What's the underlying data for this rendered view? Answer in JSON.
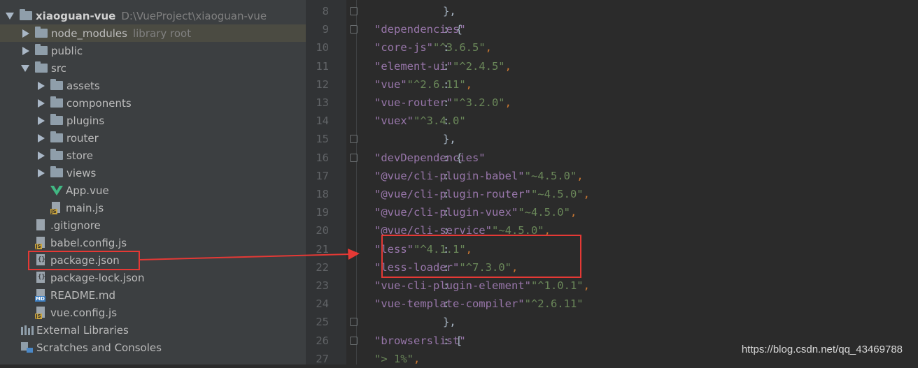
{
  "project": {
    "name": "xiaoguan-vue",
    "path": "D:\\VueProject\\xiaoguan-vue",
    "items": [
      {
        "label": "node_modules",
        "note": "library root",
        "type": "folder",
        "depth": 1,
        "state": "collapsed",
        "selected": true
      },
      {
        "label": "public",
        "type": "folder",
        "depth": 1,
        "state": "collapsed"
      },
      {
        "label": "src",
        "type": "folder",
        "depth": 1,
        "state": "expanded"
      },
      {
        "label": "assets",
        "type": "folder",
        "depth": 2,
        "state": "collapsed"
      },
      {
        "label": "components",
        "type": "folder",
        "depth": 2,
        "state": "collapsed"
      },
      {
        "label": "plugins",
        "type": "folder",
        "depth": 2,
        "state": "collapsed"
      },
      {
        "label": "router",
        "type": "folder",
        "depth": 2,
        "state": "collapsed"
      },
      {
        "label": "store",
        "type": "folder",
        "depth": 2,
        "state": "collapsed"
      },
      {
        "label": "views",
        "type": "folder",
        "depth": 2,
        "state": "collapsed"
      },
      {
        "label": "App.vue",
        "type": "vue",
        "depth": 2
      },
      {
        "label": "main.js",
        "type": "js",
        "depth": 2
      },
      {
        "label": ".gitignore",
        "type": "text",
        "depth": 1
      },
      {
        "label": "babel.config.js",
        "type": "js",
        "depth": 1
      },
      {
        "label": "package.json",
        "type": "json",
        "depth": 1
      },
      {
        "label": "package-lock.json",
        "type": "json",
        "depth": 1
      },
      {
        "label": "README.md",
        "type": "md",
        "depth": 1
      },
      {
        "label": "vue.config.js",
        "type": "js",
        "depth": 1
      }
    ],
    "external_libraries": "External Libraries",
    "scratches": "Scratches and Consoles"
  },
  "editor": {
    "lines": [
      {
        "n": "8",
        "tokens": [
          {
            "t": "},",
            "c": "txt"
          }
        ],
        "fold": true
      },
      {
        "n": "9",
        "tokens": [
          {
            "t": "\"dependencies\"",
            "c": "k"
          },
          {
            "t": ": {",
            "c": "txt"
          }
        ],
        "fold": true
      },
      {
        "n": "10",
        "tokens": [
          {
            "t": "  ",
            "c": "txt"
          },
          {
            "t": "\"core-js\"",
            "c": "k"
          },
          {
            "t": ": ",
            "c": "txt"
          },
          {
            "t": "\"^3.6.5\"",
            "c": "s"
          },
          {
            "t": ",",
            "c": "p"
          }
        ]
      },
      {
        "n": "11",
        "tokens": [
          {
            "t": "  ",
            "c": "txt"
          },
          {
            "t": "\"element-ui\"",
            "c": "k"
          },
          {
            "t": ": ",
            "c": "txt"
          },
          {
            "t": "\"^2.4.5\"",
            "c": "s"
          },
          {
            "t": ",",
            "c": "p"
          }
        ]
      },
      {
        "n": "12",
        "tokens": [
          {
            "t": "  ",
            "c": "txt"
          },
          {
            "t": "\"vue\"",
            "c": "k"
          },
          {
            "t": ": ",
            "c": "txt"
          },
          {
            "t": "\"^2.6.11\"",
            "c": "s"
          },
          {
            "t": ",",
            "c": "p"
          }
        ]
      },
      {
        "n": "13",
        "tokens": [
          {
            "t": "  ",
            "c": "txt"
          },
          {
            "t": "\"vue-router\"",
            "c": "k"
          },
          {
            "t": ": ",
            "c": "txt"
          },
          {
            "t": "\"^3.2.0\"",
            "c": "s"
          },
          {
            "t": ",",
            "c": "p"
          }
        ]
      },
      {
        "n": "14",
        "tokens": [
          {
            "t": "  ",
            "c": "txt"
          },
          {
            "t": "\"vuex\"",
            "c": "k"
          },
          {
            "t": ": ",
            "c": "txt"
          },
          {
            "t": "\"^3.4.0\"",
            "c": "s"
          }
        ]
      },
      {
        "n": "15",
        "tokens": [
          {
            "t": "},",
            "c": "txt"
          }
        ],
        "fold": true
      },
      {
        "n": "16",
        "tokens": [
          {
            "t": "\"devDependencies\"",
            "c": "k"
          },
          {
            "t": ": {",
            "c": "txt"
          }
        ],
        "fold": true
      },
      {
        "n": "17",
        "tokens": [
          {
            "t": "  ",
            "c": "txt"
          },
          {
            "t": "\"@vue/cli-plugin-babel\"",
            "c": "k"
          },
          {
            "t": ": ",
            "c": "txt"
          },
          {
            "t": "\"~4.5.0\"",
            "c": "s"
          },
          {
            "t": ",",
            "c": "p"
          }
        ]
      },
      {
        "n": "18",
        "tokens": [
          {
            "t": "  ",
            "c": "txt"
          },
          {
            "t": "\"@vue/cli-plugin-router\"",
            "c": "k"
          },
          {
            "t": ": ",
            "c": "txt"
          },
          {
            "t": "\"~4.5.0\"",
            "c": "s"
          },
          {
            "t": ",",
            "c": "p"
          }
        ]
      },
      {
        "n": "19",
        "tokens": [
          {
            "t": "  ",
            "c": "txt"
          },
          {
            "t": "\"@vue/cli-plugin-vuex\"",
            "c": "k"
          },
          {
            "t": ": ",
            "c": "txt"
          },
          {
            "t": "\"~4.5.0\"",
            "c": "s"
          },
          {
            "t": ",",
            "c": "p"
          }
        ]
      },
      {
        "n": "20",
        "tokens": [
          {
            "t": "  ",
            "c": "txt"
          },
          {
            "t": "\"@vue/cli-service\"",
            "c": "k"
          },
          {
            "t": ": ",
            "c": "txt"
          },
          {
            "t": "\"~4.5.0\"",
            "c": "s"
          },
          {
            "t": ",",
            "c": "p"
          }
        ]
      },
      {
        "n": "21",
        "tokens": [
          {
            "t": "  ",
            "c": "txt"
          },
          {
            "t": "\"less\"",
            "c": "k"
          },
          {
            "t": ": ",
            "c": "txt"
          },
          {
            "t": "\"^4.1.1\"",
            "c": "s"
          },
          {
            "t": ",",
            "c": "p"
          }
        ]
      },
      {
        "n": "22",
        "tokens": [
          {
            "t": "  ",
            "c": "txt"
          },
          {
            "t": "\"less-loader\"",
            "c": "k"
          },
          {
            "t": ": ",
            "c": "txt"
          },
          {
            "t": "\"^7.3.0\"",
            "c": "s"
          },
          {
            "t": ",",
            "c": "p"
          }
        ]
      },
      {
        "n": "23",
        "tokens": [
          {
            "t": "  ",
            "c": "txt"
          },
          {
            "t": "\"vue-cli-plugin-element\"",
            "c": "k"
          },
          {
            "t": ": ",
            "c": "txt"
          },
          {
            "t": "\"^1.0.1\"",
            "c": "s"
          },
          {
            "t": ",",
            "c": "p"
          }
        ]
      },
      {
        "n": "24",
        "tokens": [
          {
            "t": "  ",
            "c": "txt"
          },
          {
            "t": "\"vue-template-compiler\"",
            "c": "k"
          },
          {
            "t": ": ",
            "c": "txt"
          },
          {
            "t": "\"^2.6.11\"",
            "c": "s"
          }
        ]
      },
      {
        "n": "25",
        "tokens": [
          {
            "t": "},",
            "c": "txt"
          }
        ],
        "fold": true
      },
      {
        "n": "26",
        "tokens": [
          {
            "t": "\"browserslist\"",
            "c": "k"
          },
          {
            "t": ": [",
            "c": "txt"
          }
        ],
        "fold": true
      },
      {
        "n": "27",
        "tokens": [
          {
            "t": "  ",
            "c": "txt"
          },
          {
            "t": "\"> 1%\"",
            "c": "s"
          },
          {
            "t": ",",
            "c": "p"
          }
        ]
      }
    ]
  },
  "watermark": "https://blog.csdn.net/qq_43469788",
  "colors": {
    "tree_bg": "#3c3f41",
    "editor_bg": "#2b2b2b",
    "key": "#9876aa",
    "string": "#6a8759",
    "annotation": "#e53935"
  }
}
